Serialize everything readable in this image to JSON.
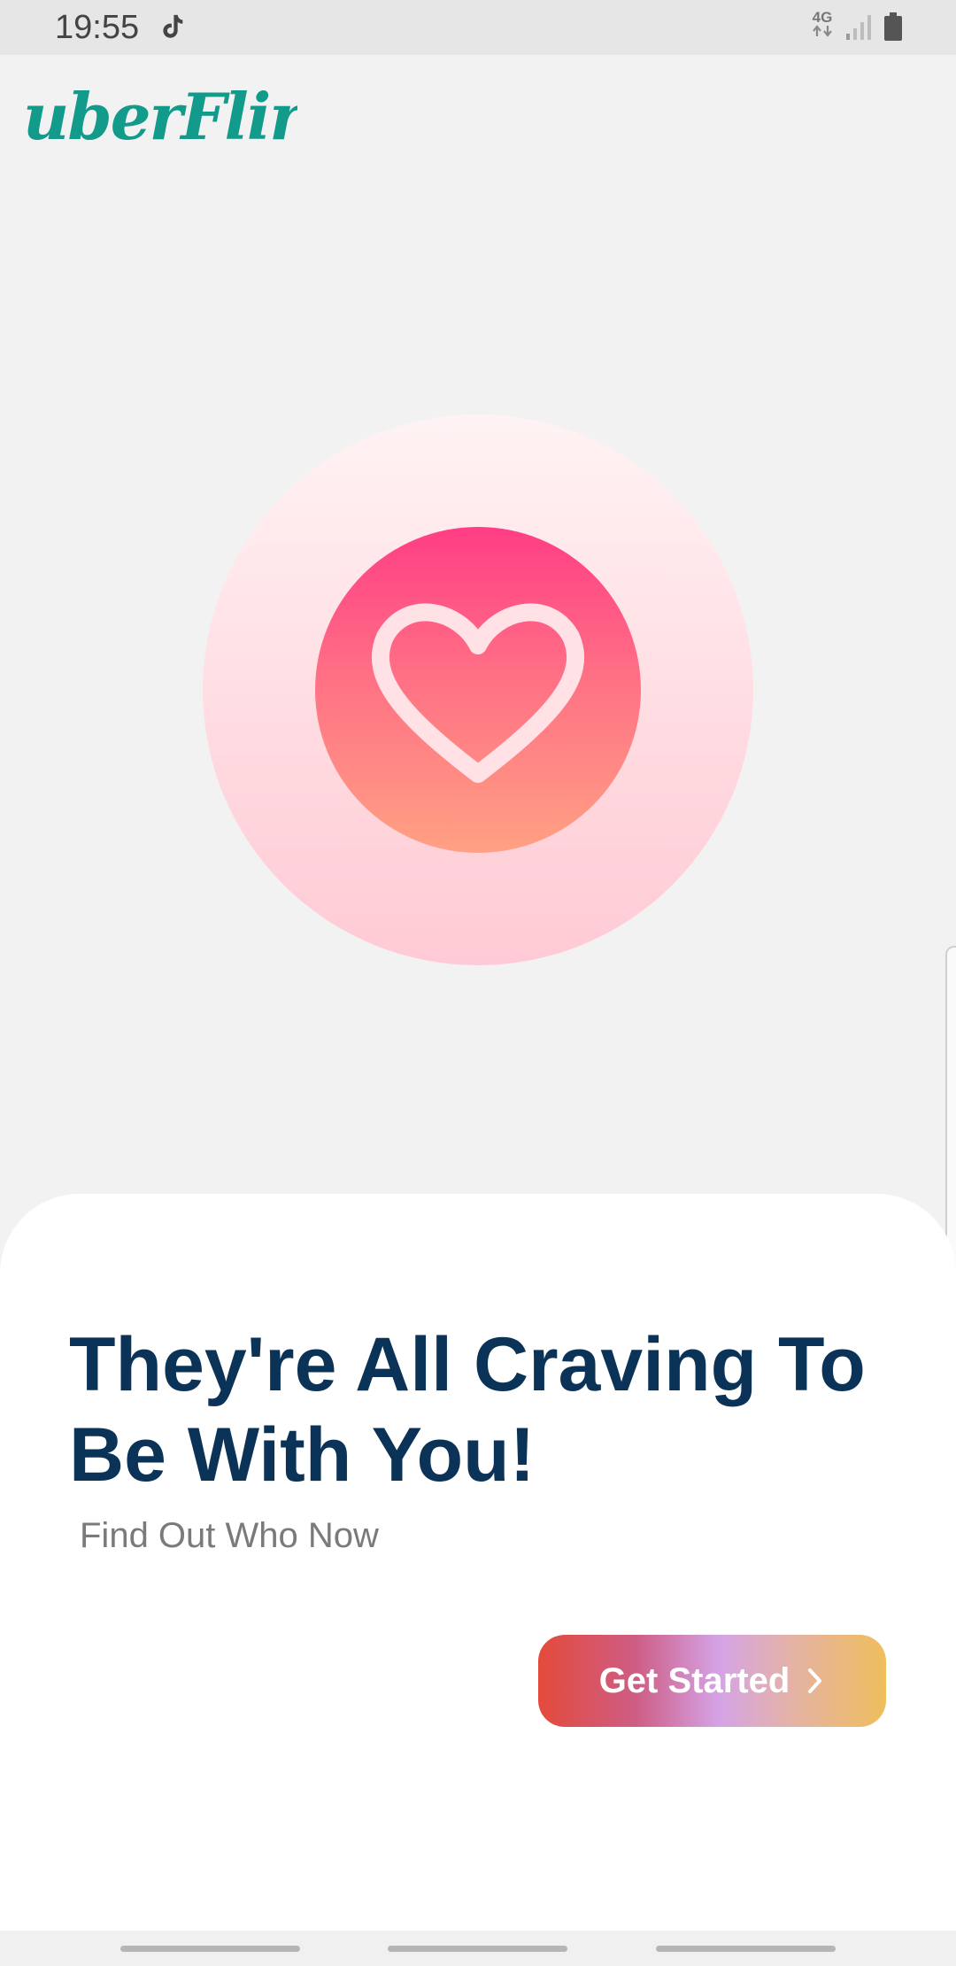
{
  "status_bar": {
    "time": "19:55",
    "network": "4G"
  },
  "brand": {
    "logo_text": "uberFlirt.",
    "accent_color": "#129a8a"
  },
  "hero": {
    "icon": "heart-icon",
    "outer_color": "#ffd6dd",
    "inner_gradient": [
      "#ff3d85",
      "#ffa183"
    ]
  },
  "onboarding": {
    "headline": "They're All Craving To Be With You!",
    "subline": "Find Out Who Now",
    "cta_label": "Get Started",
    "headline_color": "#0b3358"
  }
}
